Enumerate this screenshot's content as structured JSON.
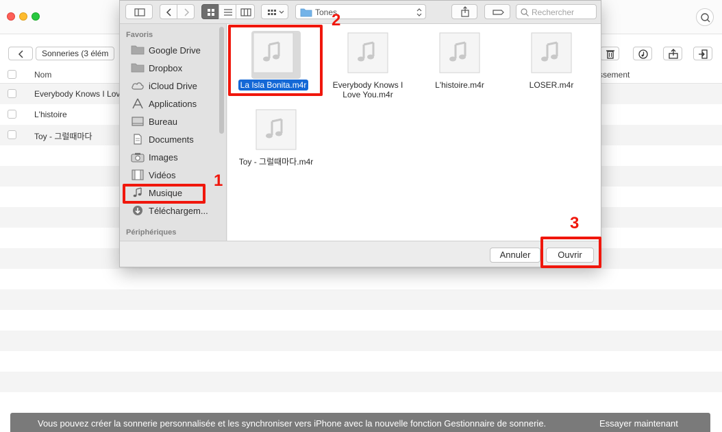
{
  "app": {
    "breadcrumb": "Sonneries (3 élém",
    "columns": {
      "name": "Nom",
      "extra": "ssement"
    },
    "rows": [
      "Everybody Knows I Lov",
      "L'histoire",
      "Toy - 그럴때마다"
    ],
    "banner": {
      "message": "Vous pouvez créer la sonnerie personnalisée et les synchroniser vers iPhone avec la nouvelle fonction Gestionnaire de sonnerie.",
      "cta": "Essayer maintenant"
    }
  },
  "dialog": {
    "path": "Tones",
    "search": {
      "placeholder": "Rechercher",
      "value": ""
    },
    "sidebar": {
      "favorites_header": "Favoris",
      "devices_header": "Périphériques",
      "items": [
        {
          "label": "Google Drive",
          "icon": "folder-icon"
        },
        {
          "label": "Dropbox",
          "icon": "folder-icon"
        },
        {
          "label": "iCloud Drive",
          "icon": "cloud-icon"
        },
        {
          "label": "Applications",
          "icon": "applications-icon"
        },
        {
          "label": "Bureau",
          "icon": "desktop-icon"
        },
        {
          "label": "Documents",
          "icon": "documents-icon"
        },
        {
          "label": "Images",
          "icon": "camera-icon"
        },
        {
          "label": "Vidéos",
          "icon": "film-icon"
        },
        {
          "label": "Musique",
          "icon": "music-note-icon"
        },
        {
          "label": "Téléchargem...",
          "icon": "download-icon"
        }
      ]
    },
    "files": [
      {
        "name": "La Isla Bonita.m4r",
        "selected": true
      },
      {
        "name": "Everybody Knows I Love You.m4r",
        "selected": false
      },
      {
        "name": "L'histoire.m4r",
        "selected": false
      },
      {
        "name": "LOSER.m4r",
        "selected": false
      },
      {
        "name": "Toy - 그럴때마다.m4r",
        "selected": false
      }
    ],
    "buttons": {
      "cancel": "Annuler",
      "open": "Ouvrir"
    }
  },
  "annotations": {
    "step1": "1",
    "step2": "2",
    "step3": "3"
  },
  "colors": {
    "highlight": "#f0170c",
    "selection": "#1468d6",
    "banner": "#7a7a7a"
  }
}
